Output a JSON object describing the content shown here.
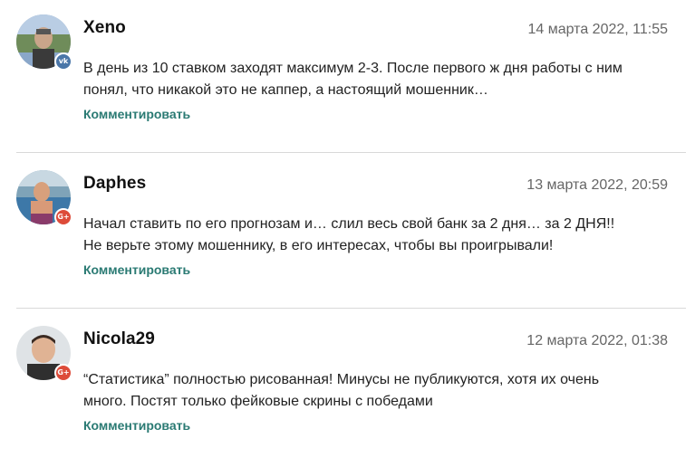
{
  "comments": [
    {
      "author": "Xeno",
      "date": "14 марта 2022, 11:55",
      "text": "В день из 10 ставком заходят максимум 2-3. После первого ж дня работы с ним понял, что никакой это не каппер, а настоящий мошенник…",
      "reply_label": "Комментировать",
      "social": "vk",
      "social_glyph": "vk",
      "social_color": "#4a76a8"
    },
    {
      "author": "Daphes",
      "date": "13 марта 2022, 20:59",
      "text": "Начал ставить по его прогнозам и… слил весь свой банк за 2 дня… за 2 ДНЯ!! Не верьте этому мошеннику, в его интересах, чтобы вы проигрывали!",
      "reply_label": "Комментировать",
      "social": "google-plus",
      "social_glyph": "G+",
      "social_color": "#dd4b39"
    },
    {
      "author": "Nicola29",
      "date": "12 марта 2022, 01:38",
      "text": "“Статистика” полностью рисованная! Минусы не публикуются, хотя их очень много. Постят только фейковые скрины с победами",
      "reply_label": "Комментировать",
      "social": "google-plus",
      "social_glyph": "G+",
      "social_color": "#dd4b39"
    }
  ],
  "colors": {
    "link": "#2a7a73",
    "date": "#666666",
    "divider": "#d9d9d9"
  }
}
